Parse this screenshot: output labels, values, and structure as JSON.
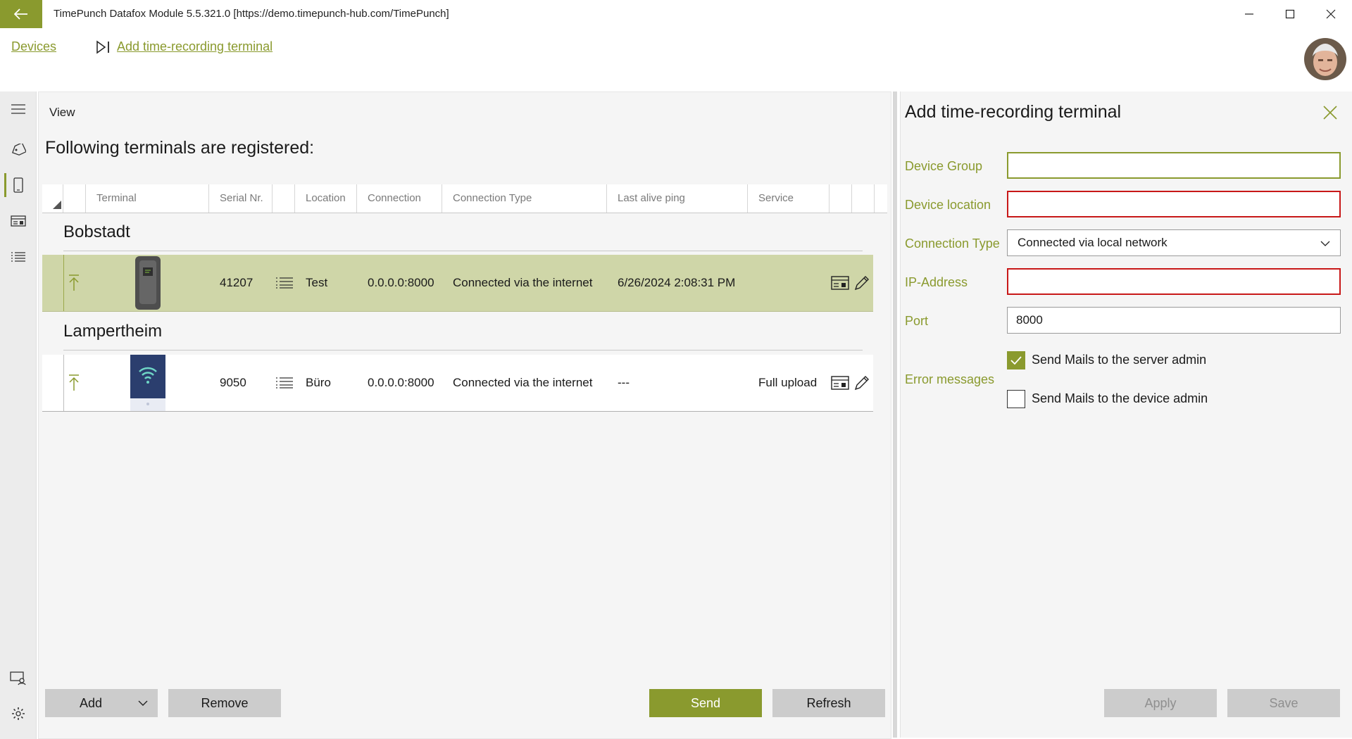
{
  "window": {
    "title": "TimePunch Datafox Module 5.5.321.0 [https://demo.timepunch-hub.com/TimePunch]"
  },
  "breadcrumb": {
    "root": "Devices",
    "current": "Add time-recording terminal"
  },
  "main": {
    "view_label": "View",
    "heading": "Following terminals are registered:",
    "columns": [
      "Terminal",
      "Serial Nr.",
      "Location",
      "Connection",
      "Connection Type",
      "Last alive ping",
      "Service"
    ],
    "groups": [
      {
        "name": "Bobstadt",
        "rows": [
          {
            "serial": "41207",
            "location": "Test",
            "connection": "0.0.0.0:8000",
            "connection_type": "Connected via the internet",
            "last_ping": "6/26/2024 2:08:31 PM",
            "service": ""
          }
        ]
      },
      {
        "name": "Lampertheim",
        "rows": [
          {
            "serial": "9050",
            "location": "Büro",
            "connection": "0.0.0.0:8000",
            "connection_type": "Connected via the internet",
            "last_ping": "---",
            "service": "Full upload"
          }
        ]
      }
    ],
    "buttons": {
      "add": "Add",
      "remove": "Remove",
      "send": "Send",
      "refresh": "Refresh"
    }
  },
  "panel": {
    "title": "Add time-recording terminal",
    "labels": {
      "device_group": "Device Group",
      "device_location": "Device location",
      "connection_type": "Connection Type",
      "ip_address": "IP-Address",
      "port": "Port",
      "error_messages": "Error messages"
    },
    "values": {
      "device_group": "",
      "device_location": "",
      "connection_type": "Connected via local network",
      "ip_address": "",
      "port": "8000"
    },
    "checkboxes": {
      "server_admin": {
        "label": "Send Mails to the server admin",
        "checked": true
      },
      "device_admin": {
        "label": "Send Mails to the device admin",
        "checked": false
      }
    },
    "buttons": {
      "apply": "Apply",
      "save": "Save"
    }
  },
  "colors": {
    "accent": "#8a9a2e",
    "selected_row": "#cfd6a8",
    "error_border": "#c81818"
  },
  "icons": [
    "back-arrow-icon",
    "minimize-icon",
    "maximize-icon",
    "close-icon",
    "step-forward-icon",
    "hamburger-menu-icon",
    "tag-icon",
    "phone-icon",
    "card-reader-icon",
    "list-icon",
    "user-monitor-icon",
    "gear-icon",
    "upload-arrow-icon",
    "terminal-card-icon",
    "pencil-icon",
    "chevron-down-icon",
    "checkmark-icon"
  ]
}
